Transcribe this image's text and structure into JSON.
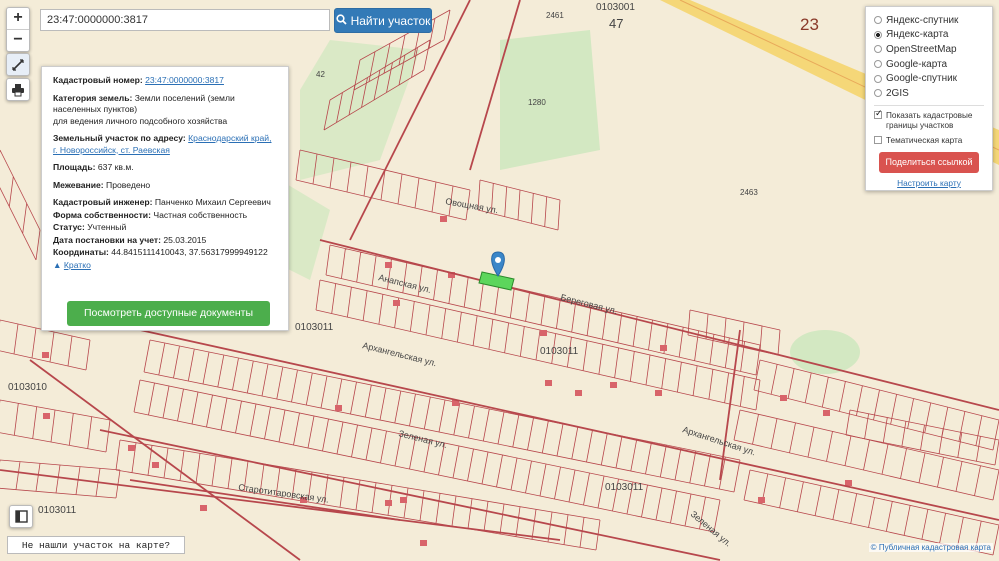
{
  "search": {
    "value": "23:47:0000000:3817",
    "button_label": "Найти участок"
  },
  "info": {
    "cadastral_label": "Кадастровый номер:",
    "cadastral_value": "23:47:0000000:3817",
    "category_label": "Категория земель:",
    "category_value": "Земли поселений (земли населенных пунктов)",
    "category_value2": "для ведения личного подсобного хозяйства",
    "address_label": "Земельный участок по адресу:",
    "address_value": "Краснодарский край, г. Новороссийск, ст. Раевская",
    "area_label": "Площадь:",
    "area_value": "637 кв.м.",
    "survey_label": "Межевание:",
    "survey_value": "Проведено",
    "engineer_label": "Кадастровый инженер:",
    "engineer_value": "Панченко Михаил Сергеевич",
    "ownership_label": "Форма собственности:",
    "ownership_value": "Частная собственность",
    "status_label": "Статус:",
    "status_value": "Учтенный",
    "date_label": "Дата постановки на учет:",
    "date_value": "25.03.2015",
    "coords_label": "Координаты:",
    "coords_value": "44.8415111410043, 37.56317999949122",
    "collapse_link": "Кратко",
    "docs_button": "Посмотреть доступные документы"
  },
  "layers": {
    "options": [
      "Яндекс-спутник",
      "Яндекс-карта",
      "OpenStreetMap",
      "Google-карта",
      "Google-спутник",
      "2GIS"
    ],
    "selected": "Яндекс-карта",
    "show_boundaries": "Показать кадастровые границы участков",
    "thematic": "Тематическая карта",
    "share_button": "Поделиться ссылкой",
    "config_link": "Настроить карту"
  },
  "bottom": {
    "not_found": "Не нашли участок на карте?",
    "attribution": "Публичная кадастровая карта"
  },
  "map_labels": {
    "block_top": "0103001",
    "block_top_num": "47",
    "region": "23",
    "block_mid": "0103011",
    "block_left": "0103011",
    "block_bl": "0103010",
    "block_bl2": "0103011",
    "block_bottom": "0103011",
    "num_1280": "1280",
    "num_2463": "2463",
    "num_2461": "2461",
    "num_42": "42",
    "street_1": "Овощная ул.",
    "street_2": "Анапская ул.",
    "street_3": "Архангельская ул.",
    "street_4": "Зеленая ул.",
    "street_5": "Архангельская ул.",
    "street_6": "Старотитаровская ул.",
    "street_7": "Зеленая ул.",
    "street_8": "Береговая ул."
  },
  "colors": {
    "map_bg": "#f4ecd8",
    "parcel_line": "#b7474c",
    "green_area": "#d3e8c2",
    "road": "#f5d778",
    "search_btn": "#337ab7",
    "docs_btn": "#4cae4c",
    "share_btn": "#d9534f"
  },
  "icons": [
    "zoom-in-icon",
    "zoom-out-icon",
    "ruler-icon",
    "print-icon",
    "search-icon",
    "map-pin-icon",
    "layers-toggle-icon"
  ]
}
